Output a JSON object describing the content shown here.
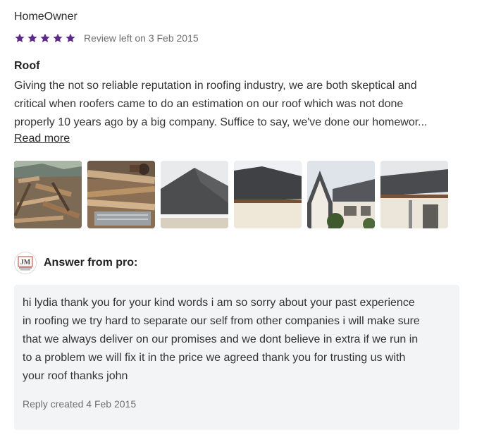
{
  "review": {
    "author": "HomeOwner",
    "rating": 5,
    "rating_max": 5,
    "star_color": "#5b2a86",
    "date": "Review left on 3 Feb 2015",
    "title": "Roof",
    "body_lines": [
      "Giving the not so reliable reputation in roofing industry, we are both skeptical and",
      "critical when roofers came to do an estimation on our roof which was not done",
      "properly 10 years ago by a big company. Suffice to say, we've done our homewor..."
    ],
    "read_more_label": "Read more",
    "photo_count": 6
  },
  "answer": {
    "avatar_text": "JM",
    "label": "Answer from pro:",
    "reply_lines": [
      "hi lydia thank you for your kind words i am so sorry about your past experience",
      "in roofing we try hard to separate our self from other companies i will make sure",
      "that we always deliver on our promises and we dont believe in extra if we run in",
      "to a problem we will fix it in the price we agreed thank you for trusting us with",
      "your roof thanks john"
    ],
    "reply_date": "Reply created 4 Feb 2015"
  }
}
